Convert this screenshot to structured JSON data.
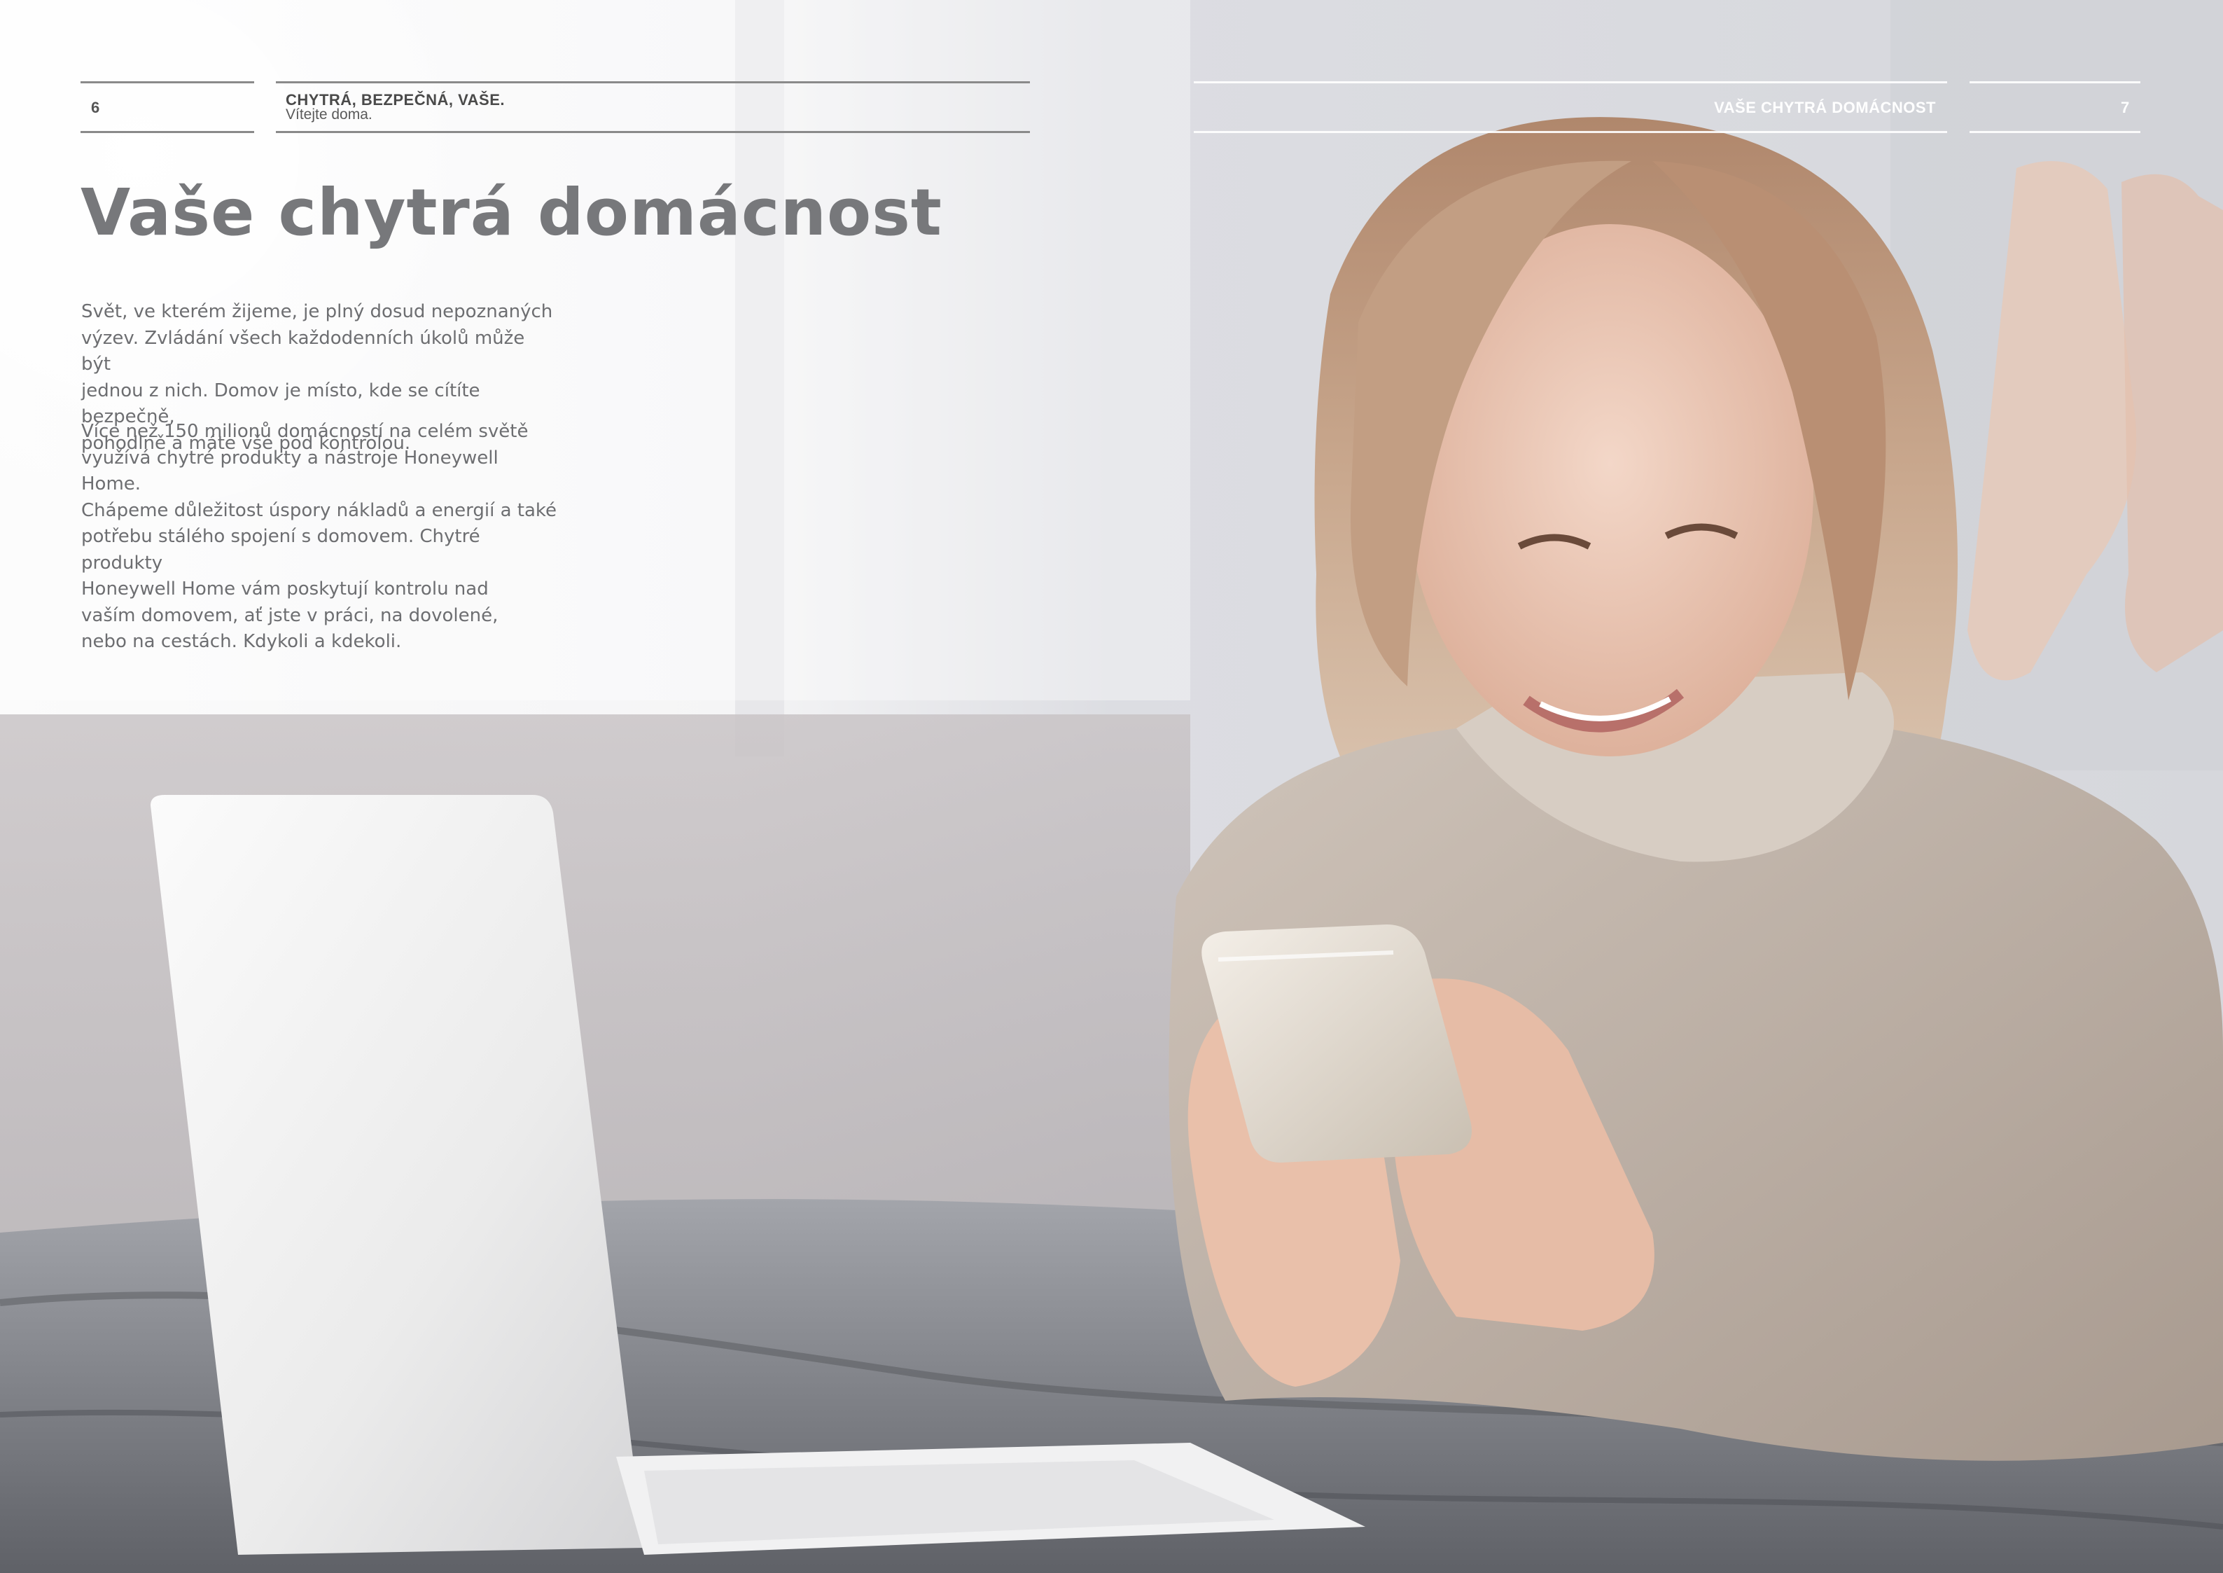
{
  "header": {
    "left_page_number": "6",
    "left_title": "CHYTRÁ, BEZPEČNÁ, VAŠE.",
    "left_subtitle": "Vítejte doma.",
    "right_title": "VAŠE CHYTRÁ DOMÁCNOST",
    "right_page_number": "7"
  },
  "main": {
    "heading": "Vaše chytrá domácnost",
    "paragraph_1_lines": [
      "Svět, ve kterém žijeme, je plný dosud nepoznaných",
      "výzev. Zvládání všech každodenních úkolů může být",
      "jednou z nich. Domov je místo, kde se cítíte bezpečně,",
      "pohodlně a máte vše pod kontrolou."
    ],
    "paragraph_2_lines": [
      "Více než 150 milionů domácností na celém světě",
      "využívá chytré produkty a nástroje Honeywell Home.",
      "Chápeme důležitost úspory nákladů a energií a také",
      "potřebu stálého spojení s domovem. Chytré produkty",
      "Honeywell Home vám poskytují kontrolu nad",
      "vaším domovem, ať jste v práci, na dovolené,",
      "nebo na cestách. Kdykoli a kdekoli."
    ]
  },
  "photo": {
    "icon": "woman-with-phone-photo"
  }
}
